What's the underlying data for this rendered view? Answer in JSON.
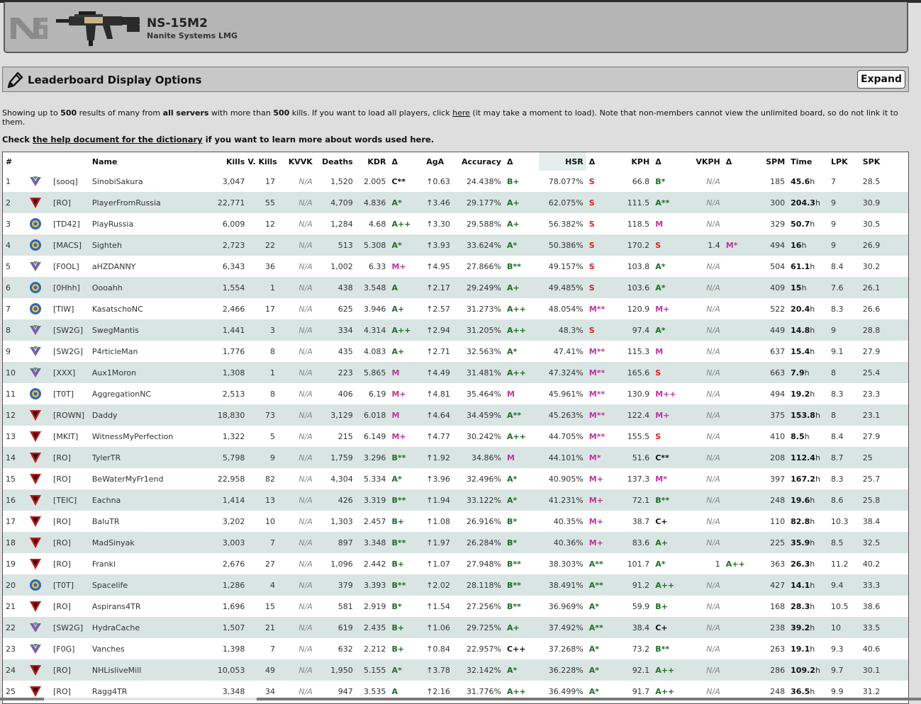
{
  "weapon": {
    "name": "NS-15M2",
    "subtitle": "Nanite Systems LMG"
  },
  "options": {
    "title": "Leaderboard Display Options",
    "expand_label": "Expand"
  },
  "info": {
    "p1": "Showing up to ",
    "results_count": "500",
    "p2": " results of many from ",
    "servers": "all servers",
    "p3": " with more than ",
    "kills_min": "500",
    "p4": " kills. If you want to load all players, click ",
    "here_link": "here",
    "p5": " (it may take a moment to load). Note that non-members cannot view the unlimited board, so do not link it to them.",
    "help_prefix": "Check ",
    "help_link": "the help document for the dictionary",
    "help_suffix": " if you want to learn more about words used here."
  },
  "columns": [
    "#",
    "",
    "",
    "Name",
    "Kills",
    "V. Kills",
    "KVVK",
    "Deaths",
    "KDR",
    "Δ",
    "AgA",
    "Accuracy",
    "Δ",
    "HSR",
    "Δ",
    "KPH",
    "Δ",
    "VKPH",
    "Δ",
    "SPM",
    "Time",
    "LPK",
    "SPK"
  ],
  "colors": {
    "faction_vs": "#7b5fa8",
    "faction_tr": "#b21f1f",
    "faction_nc": "#2b66c9",
    "grade_a": "#1f6f2a",
    "grade_m": "#c0359e",
    "grade_s": "#d42222",
    "row_alt": "#d9e5e3"
  },
  "rows": [
    {
      "rank": "1",
      "faction": "vs",
      "faction_icon": "vs-icon",
      "outfit": "[sooq]",
      "name": "SinobiSakura",
      "kills": "3,047",
      "vkills": "17",
      "kvvk": "N/A",
      "deaths": "1,520",
      "kdr": "2.005",
      "kdr_grade": "C**",
      "aga": "↑0.63",
      "acc": "24.438%",
      "acc_grade": "B+",
      "hsr": "78.077%",
      "hsr_grade": "S",
      "kph": "66.8",
      "kph_grade": "B*",
      "vkph": "N/A",
      "vkph_grade": "",
      "spm": "185",
      "time": "45.6",
      "time_unit": "h",
      "lpk": "7",
      "spk": "28.5"
    },
    {
      "rank": "2",
      "faction": "tr",
      "faction_icon": "tr-icon",
      "outfit": "[RO]",
      "name": "PlayerFromRussia",
      "kills": "22,771",
      "vkills": "55",
      "kvvk": "N/A",
      "deaths": "4,709",
      "kdr": "4.836",
      "kdr_grade": "A*",
      "aga": "↑3.46",
      "acc": "29.177%",
      "acc_grade": "A+",
      "hsr": "62.075%",
      "hsr_grade": "S",
      "kph": "111.5",
      "kph_grade": "A**",
      "vkph": "N/A",
      "vkph_grade": "",
      "spm": "300",
      "time": "204.3",
      "time_unit": "h",
      "lpk": "9",
      "spk": "30.9"
    },
    {
      "rank": "3",
      "faction": "nc",
      "faction_icon": "nc-icon",
      "outfit": "[TD42]",
      "name": "PlayRussia",
      "kills": "6,009",
      "vkills": "12",
      "kvvk": "N/A",
      "deaths": "1,284",
      "kdr": "4.68",
      "kdr_grade": "A++",
      "aga": "↑3.30",
      "acc": "29.588%",
      "acc_grade": "A+",
      "hsr": "56.382%",
      "hsr_grade": "S",
      "kph": "118.5",
      "kph_grade": "M",
      "vkph": "N/A",
      "vkph_grade": "",
      "spm": "329",
      "time": "50.7",
      "time_unit": "h",
      "lpk": "9",
      "spk": "30.5"
    },
    {
      "rank": "4",
      "faction": "nc",
      "faction_icon": "nc-icon",
      "outfit": "[MACS]",
      "name": "Sighteh",
      "kills": "2,723",
      "vkills": "22",
      "kvvk": "N/A",
      "deaths": "513",
      "kdr": "5.308",
      "kdr_grade": "A*",
      "aga": "↑3.93",
      "acc": "33.624%",
      "acc_grade": "A*",
      "hsr": "50.386%",
      "hsr_grade": "S",
      "kph": "170.2",
      "kph_grade": "S",
      "vkph": "1.4",
      "vkph_grade": "M*",
      "spm": "494",
      "time": "16",
      "time_unit": "h",
      "lpk": "9",
      "spk": "26.9"
    },
    {
      "rank": "5",
      "faction": "vs",
      "faction_icon": "vs-icon",
      "outfit": "[F0OL]",
      "name": "aHZDANNY",
      "kills": "6,343",
      "vkills": "36",
      "kvvk": "N/A",
      "deaths": "1,002",
      "kdr": "6.33",
      "kdr_grade": "M+",
      "aga": "↑4.95",
      "acc": "27.866%",
      "acc_grade": "B**",
      "hsr": "49.157%",
      "hsr_grade": "S",
      "kph": "103.8",
      "kph_grade": "A*",
      "vkph": "N/A",
      "vkph_grade": "",
      "spm": "504",
      "time": "61.1",
      "time_unit": "h",
      "lpk": "8.4",
      "spk": "30.2"
    },
    {
      "rank": "6",
      "faction": "nc",
      "faction_icon": "nc-icon",
      "outfit": "[0Hhh]",
      "name": "Oooahh",
      "kills": "1,554",
      "vkills": "1",
      "kvvk": "N/A",
      "deaths": "438",
      "kdr": "3.548",
      "kdr_grade": "A",
      "aga": "↑2.17",
      "acc": "29.249%",
      "acc_grade": "A+",
      "hsr": "49.485%",
      "hsr_grade": "S",
      "kph": "103.6",
      "kph_grade": "A*",
      "vkph": "N/A",
      "vkph_grade": "",
      "spm": "409",
      "time": "15",
      "time_unit": "h",
      "lpk": "7.6",
      "spk": "26.1"
    },
    {
      "rank": "7",
      "faction": "nc",
      "faction_icon": "nc-icon",
      "outfit": "[TIW]",
      "name": "KasatschoNC",
      "kills": "2,466",
      "vkills": "17",
      "kvvk": "N/A",
      "deaths": "625",
      "kdr": "3.946",
      "kdr_grade": "A+",
      "aga": "↑2.57",
      "acc": "31.273%",
      "acc_grade": "A++",
      "hsr": "48.054%",
      "hsr_grade": "M**",
      "kph": "120.9",
      "kph_grade": "M+",
      "vkph": "N/A",
      "vkph_grade": "",
      "spm": "522",
      "time": "20.4",
      "time_unit": "h",
      "lpk": "8.3",
      "spk": "26.6"
    },
    {
      "rank": "8",
      "faction": "vs",
      "faction_icon": "vs-icon",
      "outfit": "[SW2G]",
      "name": "SwegMantis",
      "kills": "1,441",
      "vkills": "3",
      "kvvk": "N/A",
      "deaths": "334",
      "kdr": "4.314",
      "kdr_grade": "A++",
      "aga": "↑2.94",
      "acc": "31.205%",
      "acc_grade": "A++",
      "hsr": "48.3%",
      "hsr_grade": "S",
      "kph": "97.4",
      "kph_grade": "A*",
      "vkph": "N/A",
      "vkph_grade": "",
      "spm": "449",
      "time": "14.8",
      "time_unit": "h",
      "lpk": "9",
      "spk": "28.8"
    },
    {
      "rank": "9",
      "faction": "vs",
      "faction_icon": "vs-icon",
      "outfit": "[SW2G]",
      "name": "P4rticleMan",
      "kills": "1,776",
      "vkills": "8",
      "kvvk": "N/A",
      "deaths": "435",
      "kdr": "4.083",
      "kdr_grade": "A+",
      "aga": "↑2.71",
      "acc": "32.563%",
      "acc_grade": "A*",
      "hsr": "47.41%",
      "hsr_grade": "M**",
      "kph": "115.3",
      "kph_grade": "M",
      "vkph": "N/A",
      "vkph_grade": "",
      "spm": "637",
      "time": "15.4",
      "time_unit": "h",
      "lpk": "9.1",
      "spk": "27.9"
    },
    {
      "rank": "10",
      "faction": "vs",
      "faction_icon": "vs-icon",
      "outfit": "[XXX]",
      "name": "Aux1Moron",
      "kills": "1,308",
      "vkills": "1",
      "kvvk": "N/A",
      "deaths": "223",
      "kdr": "5.865",
      "kdr_grade": "M",
      "aga": "↑4.49",
      "acc": "31.481%",
      "acc_grade": "A++",
      "hsr": "47.324%",
      "hsr_grade": "M**",
      "kph": "165.6",
      "kph_grade": "S",
      "vkph": "N/A",
      "vkph_grade": "",
      "spm": "663",
      "time": "7.9",
      "time_unit": "h",
      "lpk": "8",
      "spk": "25.4"
    },
    {
      "rank": "11",
      "faction": "nc",
      "faction_icon": "nc-icon",
      "outfit": "[T0T]",
      "name": "AggregationNC",
      "kills": "2,513",
      "vkills": "8",
      "kvvk": "N/A",
      "deaths": "406",
      "kdr": "6.19",
      "kdr_grade": "M+",
      "aga": "↑4.81",
      "acc": "35.464%",
      "acc_grade": "M",
      "hsr": "45.961%",
      "hsr_grade": "M**",
      "kph": "130.9",
      "kph_grade": "M++",
      "vkph": "N/A",
      "vkph_grade": "",
      "spm": "494",
      "time": "19.2",
      "time_unit": "h",
      "lpk": "8.3",
      "spk": "23.3"
    },
    {
      "rank": "12",
      "faction": "tr",
      "faction_icon": "tr-icon",
      "outfit": "[ROWN]",
      "name": "Daddy",
      "kills": "18,830",
      "vkills": "73",
      "kvvk": "N/A",
      "deaths": "3,129",
      "kdr": "6.018",
      "kdr_grade": "M",
      "aga": "↑4.64",
      "acc": "34.459%",
      "acc_grade": "A**",
      "hsr": "45.263%",
      "hsr_grade": "M**",
      "kph": "122.4",
      "kph_grade": "M+",
      "vkph": "N/A",
      "vkph_grade": "",
      "spm": "375",
      "time": "153.8",
      "time_unit": "h",
      "lpk": "8",
      "spk": "23.1"
    },
    {
      "rank": "13",
      "faction": "tr",
      "faction_icon": "tr-icon",
      "outfit": "[MKIT]",
      "name": "WitnessMyPerfection",
      "kills": "1,322",
      "vkills": "5",
      "kvvk": "N/A",
      "deaths": "215",
      "kdr": "6.149",
      "kdr_grade": "M+",
      "aga": "↑4.77",
      "acc": "30.242%",
      "acc_grade": "A++",
      "hsr": "44.705%",
      "hsr_grade": "M**",
      "kph": "155.5",
      "kph_grade": "S",
      "vkph": "N/A",
      "vkph_grade": "",
      "spm": "410",
      "time": "8.5",
      "time_unit": "h",
      "lpk": "8.4",
      "spk": "27.9"
    },
    {
      "rank": "14",
      "faction": "tr",
      "faction_icon": "tr-icon",
      "outfit": "[RO]",
      "name": "TylerTR",
      "kills": "5,798",
      "vkills": "9",
      "kvvk": "N/A",
      "deaths": "1,759",
      "kdr": "3.296",
      "kdr_grade": "B**",
      "aga": "↑1.92",
      "acc": "34.86%",
      "acc_grade": "M",
      "hsr": "44.101%",
      "hsr_grade": "M*",
      "kph": "51.6",
      "kph_grade": "C**",
      "vkph": "N/A",
      "vkph_grade": "",
      "spm": "208",
      "time": "112.4",
      "time_unit": "h",
      "lpk": "8.7",
      "spk": "25"
    },
    {
      "rank": "15",
      "faction": "tr",
      "faction_icon": "tr-icon",
      "outfit": "[RO]",
      "name": "BeWaterMyFr1end",
      "kills": "22,958",
      "vkills": "82",
      "kvvk": "N/A",
      "deaths": "4,304",
      "kdr": "5.334",
      "kdr_grade": "A*",
      "aga": "↑3.96",
      "acc": "32.496%",
      "acc_grade": "A*",
      "hsr": "40.905%",
      "hsr_grade": "M+",
      "kph": "137.3",
      "kph_grade": "M*",
      "vkph": "N/A",
      "vkph_grade": "",
      "spm": "397",
      "time": "167.2",
      "time_unit": "h",
      "lpk": "8.3",
      "spk": "25.7"
    },
    {
      "rank": "16",
      "faction": "tr",
      "faction_icon": "tr-icon",
      "outfit": "[TEIC]",
      "name": "Eachna",
      "kills": "1,414",
      "vkills": "13",
      "kvvk": "N/A",
      "deaths": "426",
      "kdr": "3.319",
      "kdr_grade": "B**",
      "aga": "↑1.94",
      "acc": "33.122%",
      "acc_grade": "A*",
      "hsr": "41.231%",
      "hsr_grade": "M+",
      "kph": "72.1",
      "kph_grade": "B**",
      "vkph": "N/A",
      "vkph_grade": "",
      "spm": "248",
      "time": "19.6",
      "time_unit": "h",
      "lpk": "8.6",
      "spk": "25.8"
    },
    {
      "rank": "17",
      "faction": "tr",
      "faction_icon": "tr-icon",
      "outfit": "[RO]",
      "name": "BaluTR",
      "kills": "3,202",
      "vkills": "10",
      "kvvk": "N/A",
      "deaths": "1,303",
      "kdr": "2.457",
      "kdr_grade": "B+",
      "aga": "↑1.08",
      "acc": "26.916%",
      "acc_grade": "B*",
      "hsr": "40.35%",
      "hsr_grade": "M+",
      "kph": "38.7",
      "kph_grade": "C+",
      "vkph": "N/A",
      "vkph_grade": "",
      "spm": "110",
      "time": "82.8",
      "time_unit": "h",
      "lpk": "10.3",
      "spk": "38.4"
    },
    {
      "rank": "18",
      "faction": "tr",
      "faction_icon": "tr-icon",
      "outfit": "[RO]",
      "name": "MadSinyak",
      "kills": "3,003",
      "vkills": "7",
      "kvvk": "N/A",
      "deaths": "897",
      "kdr": "3.348",
      "kdr_grade": "B**",
      "aga": "↑1.97",
      "acc": "26.284%",
      "acc_grade": "B*",
      "hsr": "40.36%",
      "hsr_grade": "M+",
      "kph": "83.6",
      "kph_grade": "A+",
      "vkph": "N/A",
      "vkph_grade": "",
      "spm": "225",
      "time": "35.9",
      "time_unit": "h",
      "lpk": "8.5",
      "spk": "32.5"
    },
    {
      "rank": "19",
      "faction": "tr",
      "faction_icon": "tr-icon",
      "outfit": "[RO]",
      "name": "Franki",
      "kills": "2,676",
      "vkills": "27",
      "kvvk": "N/A",
      "deaths": "1,096",
      "kdr": "2.442",
      "kdr_grade": "B+",
      "aga": "↑1.07",
      "acc": "27.948%",
      "acc_grade": "B**",
      "hsr": "38.303%",
      "hsr_grade": "A**",
      "kph": "101.7",
      "kph_grade": "A*",
      "vkph": "1",
      "vkph_grade": "A++",
      "spm": "363",
      "time": "26.3",
      "time_unit": "h",
      "lpk": "11.2",
      "spk": "40.2"
    },
    {
      "rank": "20",
      "faction": "nc",
      "faction_icon": "nc-icon",
      "outfit": "[T0T]",
      "name": "Spacelife",
      "kills": "1,286",
      "vkills": "4",
      "kvvk": "N/A",
      "deaths": "379",
      "kdr": "3.393",
      "kdr_grade": "B**",
      "aga": "↑2.02",
      "acc": "28.118%",
      "acc_grade": "B**",
      "hsr": "38.491%",
      "hsr_grade": "A**",
      "kph": "91.2",
      "kph_grade": "A++",
      "vkph": "N/A",
      "vkph_grade": "",
      "spm": "427",
      "time": "14.1",
      "time_unit": "h",
      "lpk": "9.4",
      "spk": "33.3"
    },
    {
      "rank": "21",
      "faction": "tr",
      "faction_icon": "tr-icon",
      "outfit": "[RO]",
      "name": "Aspirans4TR",
      "kills": "1,696",
      "vkills": "15",
      "kvvk": "N/A",
      "deaths": "581",
      "kdr": "2.919",
      "kdr_grade": "B*",
      "aga": "↑1.54",
      "acc": "27.256%",
      "acc_grade": "B**",
      "hsr": "36.969%",
      "hsr_grade": "A*",
      "kph": "59.9",
      "kph_grade": "B+",
      "vkph": "N/A",
      "vkph_grade": "",
      "spm": "168",
      "time": "28.3",
      "time_unit": "h",
      "lpk": "10.5",
      "spk": "38.6"
    },
    {
      "rank": "22",
      "faction": "vs",
      "faction_icon": "vs-icon",
      "outfit": "[SW2G]",
      "name": "HydraCache",
      "kills": "1,507",
      "vkills": "21",
      "kvvk": "N/A",
      "deaths": "619",
      "kdr": "2.435",
      "kdr_grade": "B+",
      "aga": "↑1.06",
      "acc": "29.725%",
      "acc_grade": "A+",
      "hsr": "37.492%",
      "hsr_grade": "A**",
      "kph": "38.4",
      "kph_grade": "C+",
      "vkph": "N/A",
      "vkph_grade": "",
      "spm": "238",
      "time": "39.2",
      "time_unit": "h",
      "lpk": "10",
      "spk": "33.5"
    },
    {
      "rank": "23",
      "faction": "vs",
      "faction_icon": "vs-icon",
      "outfit": "[F0G]",
      "name": "Vanches",
      "kills": "1,398",
      "vkills": "7",
      "kvvk": "N/A",
      "deaths": "632",
      "kdr": "2.212",
      "kdr_grade": "B+",
      "aga": "↑0.84",
      "acc": "22.957%",
      "acc_grade": "C++",
      "hsr": "37.268%",
      "hsr_grade": "A*",
      "kph": "73.2",
      "kph_grade": "B**",
      "vkph": "N/A",
      "vkph_grade": "",
      "spm": "263",
      "time": "19.1",
      "time_unit": "h",
      "lpk": "9.3",
      "spk": "40.6"
    },
    {
      "rank": "24",
      "faction": "tr",
      "faction_icon": "tr-icon",
      "outfit": "[RO]",
      "name": "NHLisliveMill",
      "kills": "10,053",
      "vkills": "49",
      "kvvk": "N/A",
      "deaths": "1,950",
      "kdr": "5.155",
      "kdr_grade": "A*",
      "aga": "↑3.78",
      "acc": "32.142%",
      "acc_grade": "A*",
      "hsr": "36.228%",
      "hsr_grade": "A*",
      "kph": "92.1",
      "kph_grade": "A++",
      "vkph": "N/A",
      "vkph_grade": "",
      "spm": "286",
      "time": "109.2",
      "time_unit": "h",
      "lpk": "9.7",
      "spk": "30.1"
    },
    {
      "rank": "25",
      "faction": "tr",
      "faction_icon": "tr-icon",
      "outfit": "[RO]",
      "name": "Ragg4TR",
      "kills": "3,348",
      "vkills": "34",
      "kvvk": "N/A",
      "deaths": "947",
      "kdr": "3.535",
      "kdr_grade": "A",
      "aga": "↑2.16",
      "acc": "31.776%",
      "acc_grade": "A++",
      "hsr": "36.499%",
      "hsr_grade": "A*",
      "kph": "91.7",
      "kph_grade": "A++",
      "vkph": "N/A",
      "vkph_grade": "",
      "spm": "248",
      "time": "36.5",
      "time_unit": "h",
      "lpk": "9.9",
      "spk": "31.2"
    }
  ]
}
